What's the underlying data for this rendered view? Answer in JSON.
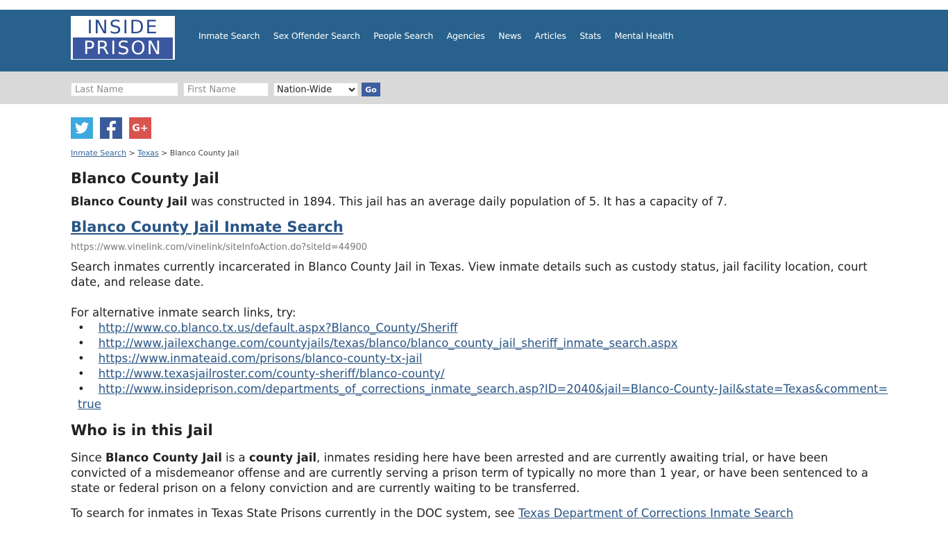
{
  "logo": {
    "line1": "INSIDE",
    "line2": "PRISON"
  },
  "nav": {
    "items": [
      "Inmate Search",
      "Sex Offender Search",
      "People Search",
      "Agencies",
      "News",
      "Articles",
      "Stats",
      "Mental Health"
    ]
  },
  "search": {
    "last_name_placeholder": "Last Name",
    "first_name_placeholder": "First Name",
    "scope_selected": "Nation-Wide",
    "go_label": "Go"
  },
  "social": {
    "twitter": "twitter-icon",
    "facebook": "facebook-icon",
    "google_plus": "google-plus-icon"
  },
  "breadcrumb": {
    "items": [
      "Inmate Search",
      "Texas"
    ],
    "current": "Blanco County Jail",
    "separator": ">"
  },
  "page": {
    "title": "Blanco County Jail",
    "intro_bold": "Blanco County Jail",
    "intro_rest": " was constructed in 1894. This jail has an average daily population of 5. It has a capacity of 7.",
    "search_link_title": "Blanco County Jail Inmate Search",
    "search_url": "https://www.vinelink.com/vinelink/siteInfoAction.do?siteId=44900",
    "search_desc": "Search inmates currently incarcerated in Blanco County Jail in Texas. View inmate details such as custody status, jail facility location, court date, and release date.",
    "alt_intro": "For alternative inmate search links, try:",
    "alt_links": [
      "http://www.co.blanco.tx.us/default.aspx?Blanco_County/Sheriff",
      "http://www.jailexchange.com/countyjails/texas/blanco/blanco_county_jail_sheriff_inmate_search.aspx",
      "https://www.inmateaid.com/prisons/blanco-county-tx-jail",
      "http://www.texasjailroster.com/county-sheriff/blanco-county/",
      "http://www.insideprison.com/departments_of_corrections_inmate_search.asp?ID=2040&jail=Blanco-County-Jail&state=Texas&comment=true"
    ],
    "who_heading": "Who is in this Jail",
    "who_p1": "Since ",
    "who_b1": "Blanco County Jail",
    "who_p2": " is a ",
    "who_b2": "county jail",
    "who_p3": ", inmates residing here have been arrested and are currently awaiting trial, or have been convicted of a misdemeanor offense and are currently serving a prison term of typically no more than 1 year, or have been sentenced to a state or federal prison on a felony conviction and are currently waiting to be transferred.",
    "doc_text": "To search for inmates in Texas State Prisons currently in the DOC system, see ",
    "doc_link": "Texas Department of Corrections Inmate Search"
  },
  "colors": {
    "header": "#28628c",
    "searchbar": "#d9d9d9",
    "link": "#295585",
    "go": "#3d5ea0"
  }
}
